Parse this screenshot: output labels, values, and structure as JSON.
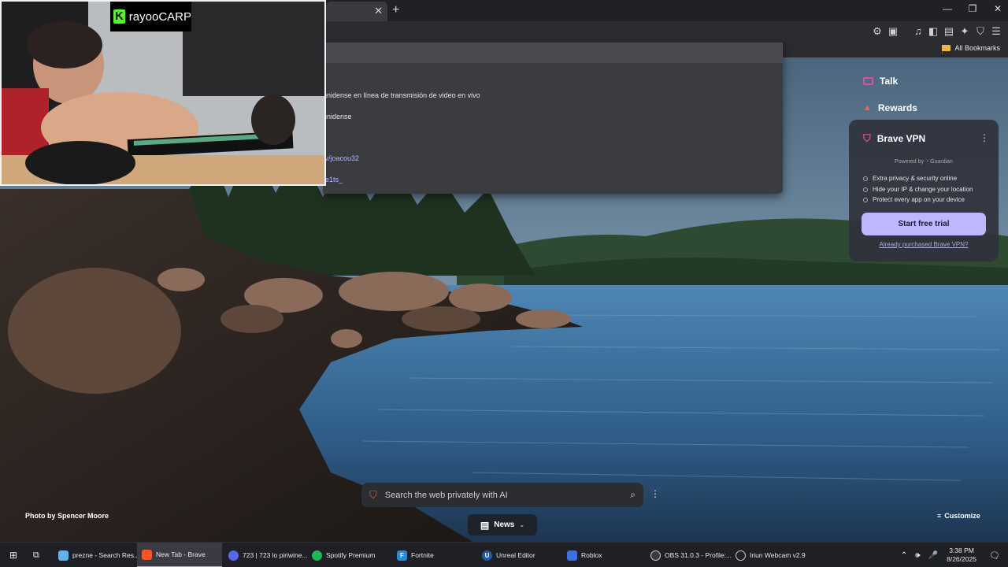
{
  "webcam": {
    "streamer_name": "rayooCARP",
    "logo_letter": "K"
  },
  "dropdown": {
    "rows": [
      {
        "text": "unidense en línea de transmisión de video en vivo",
        "kind": "text"
      },
      {
        "text": "unidense",
        "kind": "text"
      },
      {
        "text": "tv/joacou32",
        "kind": "link"
      },
      {
        "text": "re1ts_",
        "kind": "link"
      }
    ]
  },
  "bookmarks": {
    "all_label": "All Bookmarks"
  },
  "panel": {
    "talk_label": "Talk",
    "rewards_label": "Rewards",
    "vpn": {
      "title": "Brave VPN",
      "powered_by": "Powered by",
      "partner": "Guardian",
      "features": [
        "Extra privacy & security online",
        "Hide your IP & change your location",
        "Protect every app on your device"
      ],
      "trial_label": "Start free trial",
      "purchased_label": "Already purchased Brave VPN?"
    }
  },
  "search": {
    "placeholder": "Search the web privately with AI"
  },
  "news_label": "News",
  "photo_credit": "Photo by Spencer Moore",
  "customize_label": "Customize",
  "taskbar": {
    "items": [
      {
        "label": "prezne - Search Res...",
        "color": "#5fb3e8"
      },
      {
        "label": "New Tab - Brave",
        "color": "#fb542b"
      },
      {
        "label": "723 | 723 lo piriwine...",
        "color": "#5865f2"
      },
      {
        "label": "Spotify Premium",
        "color": "#1db954"
      },
      {
        "label": "Fortnite",
        "color": "#2a8bd6"
      },
      {
        "label": "Unreal Editor",
        "color": "#1e5aa8"
      },
      {
        "label": "Roblox",
        "color": "#3f6fe6"
      },
      {
        "label": "OBS 31.0.3 - Profile:...",
        "color": "#3a3a3a"
      },
      {
        "label": "Iriun Webcam v2.9",
        "color": "#222"
      }
    ],
    "time": "3:38 PM",
    "date": "8/26/2025"
  }
}
